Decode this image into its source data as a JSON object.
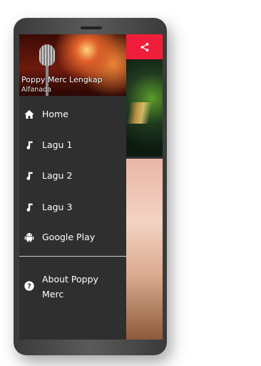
{
  "drawer": {
    "header": {
      "title": "Poppy Merc Lengkap",
      "subtitle": "Alfanada"
    },
    "items": [
      {
        "label": "Home",
        "icon": "home-icon"
      },
      {
        "label": "Lagu 1",
        "icon": "music-note-icon"
      },
      {
        "label": "Lagu 2",
        "icon": "music-note-icon"
      },
      {
        "label": "Lagu 3",
        "icon": "music-note-icon"
      },
      {
        "label": "Google Play",
        "icon": "android-icon"
      }
    ],
    "about": {
      "label": "About Poppy Merc",
      "icon": "help-circle-icon"
    }
  },
  "app": {
    "accent_color": "#f01e3a",
    "share_icon": "share-icon"
  }
}
